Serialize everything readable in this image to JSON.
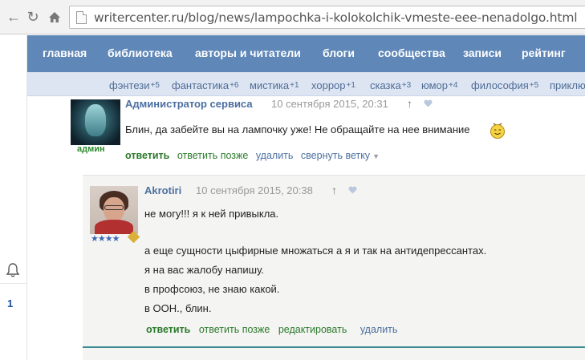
{
  "browser": {
    "url": "writercenter.ru/blog/news/lampochka-i-kolokolchik-vmeste-eee-nenadolgo.html"
  },
  "main_nav": [
    "главная",
    "библиотека",
    "авторы и читатели",
    "блоги",
    "сообщества",
    "записи",
    "рейтинг"
  ],
  "tags": [
    {
      "label": "фэнтези",
      "count": "+5"
    },
    {
      "label": "фантастика",
      "count": "+6"
    },
    {
      "label": "мистика",
      "count": "+1"
    },
    {
      "label": "хоррор",
      "count": "+1"
    },
    {
      "label": "сказка",
      "count": "+3"
    },
    {
      "label": "юмор",
      "count": "+4"
    },
    {
      "label": "философия",
      "count": "+5"
    },
    {
      "label": "приклю",
      "count": ""
    }
  ],
  "sidebar": {
    "count": "1"
  },
  "comment1": {
    "author": "Администратор сервиса",
    "date": "10 сентября 2015, 20:31",
    "up_arrow": "↑",
    "badge": "админ",
    "text": "Блин, да забейте вы на лампочку уже! Не обращайте на нее внимание",
    "actions": {
      "reply": "ответить",
      "reply_later": "ответить позже",
      "delete": "удалить",
      "collapse": "свернуть ветку"
    }
  },
  "comment2": {
    "author": "Akrotiri",
    "date": "10 сентября 2015, 20:38",
    "up_arrow": "↑",
    "stars": "★★★★",
    "lines": [
      "не могу!!! я к ней привыкла.",
      "а еще сущности цыфирные множаться а я и так на антидепрессантах.",
      "я на вас жалобу напишу.",
      "в профсоюз, не знаю какой.",
      "в ООН., блин."
    ],
    "actions": {
      "reply": "ответить",
      "reply_later": "ответить позже",
      "edit": "редактировать",
      "delete": "удалить"
    }
  },
  "colors": {
    "nav_bg": "#5f87b8",
    "tag_bg": "#dde5f3",
    "link_green": "#2b7a2b",
    "link_blue": "#4c6fa0"
  }
}
